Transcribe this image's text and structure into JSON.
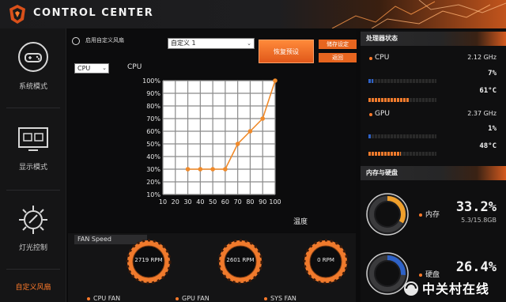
{
  "app": {
    "title": "CONTROL CENTER"
  },
  "sidebar": {
    "items": [
      {
        "label": "系统模式",
        "icon": "gamepad-icon"
      },
      {
        "label": "显示模式",
        "icon": "display-icon"
      },
      {
        "label": "灯光控制",
        "icon": "lighting-icon"
      },
      {
        "label": "自定义风扇",
        "icon": "fan-custom-icon",
        "active": true
      }
    ]
  },
  "fan_control": {
    "enable_label": "启用自定义风扇",
    "profile_value": "自定义 1",
    "reset_label": "恢复预设",
    "save_label": "储存设定",
    "back_label": "返回",
    "sensor_value": "CPU",
    "y_axis_title": "CPU",
    "x_axis_title": "温度"
  },
  "chart_data": {
    "type": "line",
    "x": [
      30,
      40,
      50,
      60,
      70,
      80,
      90,
      100
    ],
    "y": [
      30,
      30,
      30,
      30,
      50,
      60,
      70,
      100
    ],
    "xlabel": "温度",
    "ylabel": "CPU",
    "xlim": [
      10,
      100
    ],
    "ylim": [
      10,
      100
    ],
    "x_ticks": [
      "10",
      "20",
      "30",
      "40",
      "50",
      "60",
      "70",
      "80",
      "90",
      "100"
    ],
    "y_ticks": [
      "100%",
      "90%",
      "80%",
      "70%",
      "60%",
      "50%",
      "40%",
      "30%",
      "20%",
      "10%"
    ],
    "grid": true,
    "line_color": "#f08a2a",
    "grid_color": "#8a8a8a"
  },
  "fan_speed": {
    "title": "FAN Speed",
    "fans": [
      {
        "label": "CPU FAN",
        "rpm": "2719 RPM"
      },
      {
        "label": "GPU FAN",
        "rpm": "2601 RPM"
      },
      {
        "label": "SYS FAN",
        "rpm": "0 RPM"
      }
    ]
  },
  "processor_status": {
    "title": "处理器状态",
    "cpu": {
      "name": "CPU",
      "freq": "2.12 GHz",
      "usage": "7%",
      "usage_fraction": 0.07,
      "temp": "61°C",
      "temp_fraction": 0.61
    },
    "gpu": {
      "name": "GPU",
      "freq": "2.37 GHz",
      "usage": "1%",
      "usage_fraction": 0.01,
      "temp": "48°C",
      "temp_fraction": 0.48
    }
  },
  "memory_storage": {
    "title": "内存与硬盘",
    "memory": {
      "label": "内存",
      "percent": "33.2%",
      "fraction": 0.332,
      "detail": "5.3/15.8GB"
    },
    "disk": {
      "label": "硬盘",
      "percent": "26.4%",
      "fraction": 0.264
    }
  },
  "watermark": {
    "text": "中关村在线"
  },
  "colors": {
    "accent": "#ff7a2a",
    "blue": "#2e62c8",
    "panel": "#0c0c0d"
  }
}
